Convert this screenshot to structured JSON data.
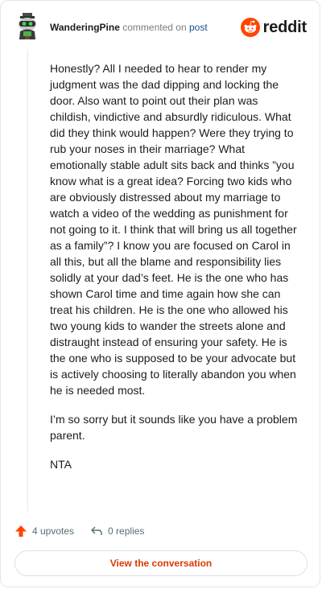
{
  "header": {
    "username": "WanderingPine",
    "commented_on": "commented on",
    "post_link": "post",
    "brand_word": "reddit",
    "avatar_icon": "snoo-avatar-icon",
    "brand_icon": "reddit-alien-icon"
  },
  "comment": {
    "paragraphs": [
      "Honestly? All I needed to hear to render my judgment was the dad dipping and locking the door. Also want to point out their plan was childish, vindictive and absurdly ridiculous. What did they think would happen? Were they trying to rub your noses in their marriage? What emotionally stable adult sits back and thinks ”you know what is a great idea? Forcing two kids who are obviously distressed about my marriage to watch a video of the wedding as punishment for not going to it. I think that will bring us all together as a family”? I know you are focused on Carol in all this, but all the blame and responsibility lies solidly at your dad’s feet. He is the one who has shown Carol time and time again how she can treat his children. He is the one who allowed his two young kids to wander the streets alone and distraught instead of ensuring your safety. He is the one who is supposed to be your advocate but is actively choosing to literally abandon you when he is needed most.",
      "I’m so sorry but it sounds like you have a problem parent.",
      "NTA"
    ]
  },
  "actions": {
    "upvotes": "4 upvotes",
    "replies": "0 replies",
    "upvote_icon": "upvote-arrow-icon",
    "reply_icon": "reply-arrow-icon"
  },
  "view_button": "View the conversation",
  "colors": {
    "accent_orange": "#ff4500",
    "link_blue": "#1c4e8c",
    "button_text": "#d93a00"
  }
}
